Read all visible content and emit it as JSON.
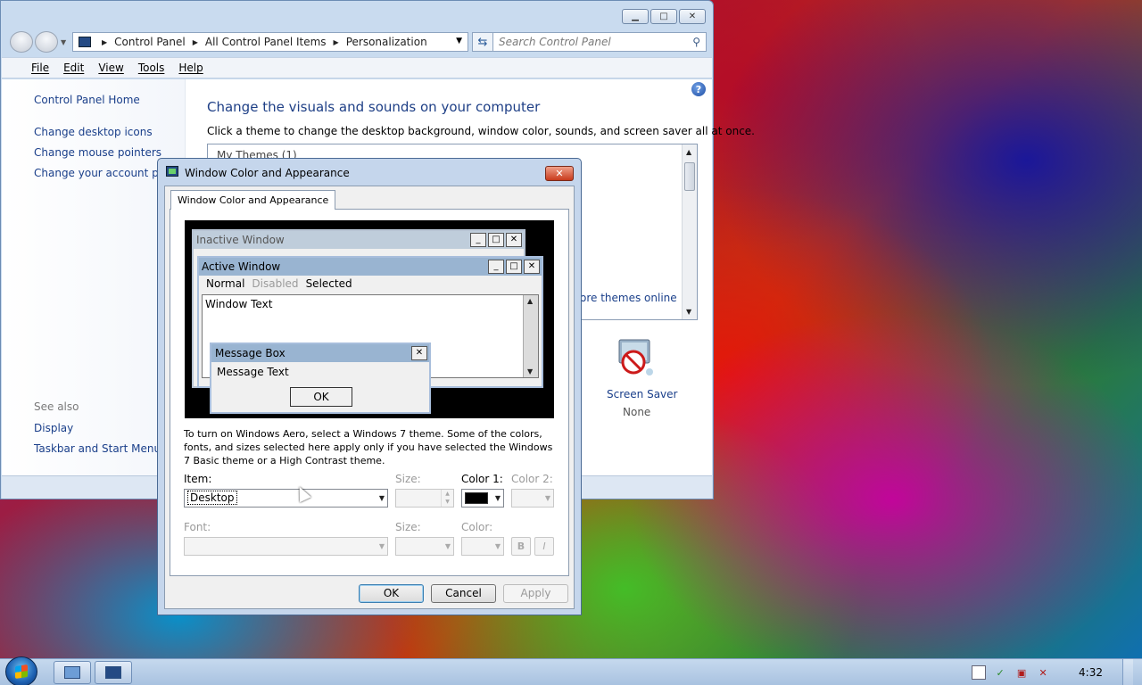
{
  "control_panel": {
    "caption_buttons": {
      "minimize": "▁",
      "maximize": "□",
      "close": "✕"
    },
    "nav": {
      "back_icon": "back-arrow-icon",
      "forward_icon": "forward-arrow-icon"
    },
    "address": {
      "crumbs": [
        "Control Panel",
        "All Control Panel Items",
        "Personalization"
      ]
    },
    "search": {
      "placeholder": "Search Control Panel"
    },
    "menu": [
      "File",
      "Edit",
      "View",
      "Tools",
      "Help"
    ],
    "sidebar": {
      "home": "Control Panel Home",
      "links": [
        "Change desktop icons",
        "Change mouse pointers",
        "Change your account pict"
      ],
      "see_also_label": "See also",
      "see_also_links": [
        "Display",
        "Taskbar and Start Menu"
      ]
    },
    "main": {
      "heading": "Change the visuals and sounds on your computer",
      "description": "Click a theme to change the desktop background, window color, sounds, and screen saver all at once.",
      "theme_group": "My Themes (1)",
      "more_themes_link": "ore themes online",
      "screen_saver": {
        "label": "Screen Saver",
        "value": "None"
      }
    }
  },
  "dialog": {
    "title": "Window Color and Appearance",
    "tab": "Window Color and Appearance",
    "preview": {
      "inactive_title": "Inactive Window",
      "active_title": "Active Window",
      "menu_normal": "Normal",
      "menu_disabled": "Disabled",
      "menu_selected": "Selected",
      "window_text": "Window Text",
      "msgbox_title": "Message Box",
      "msgbox_text": "Message Text",
      "msgbox_ok": "OK"
    },
    "info": "To turn on Windows Aero, select a Windows 7 theme.  Some of the colors, fonts, and sizes selected here apply only if you have selected the Windows 7 Basic theme or a High Contrast theme.",
    "labels": {
      "item": "Item:",
      "size": "Size:",
      "color1": "Color 1:",
      "color2": "Color 2:",
      "font": "Font:",
      "font_size": "Size:",
      "font_color": "Color:"
    },
    "item_value": "Desktop",
    "color1_value": "#000000",
    "bold": "B",
    "italic": "I",
    "buttons": {
      "ok": "OK",
      "cancel": "Cancel",
      "apply": "Apply"
    }
  },
  "taskbar": {
    "clock": "4:32",
    "apps": [
      "remote-desktop-app-icon",
      "control-panel-app-icon"
    ],
    "tray_icons": [
      "action-center-icon",
      "network-icon",
      "network-adapter-icon",
      "volume-muted-icon"
    ]
  }
}
